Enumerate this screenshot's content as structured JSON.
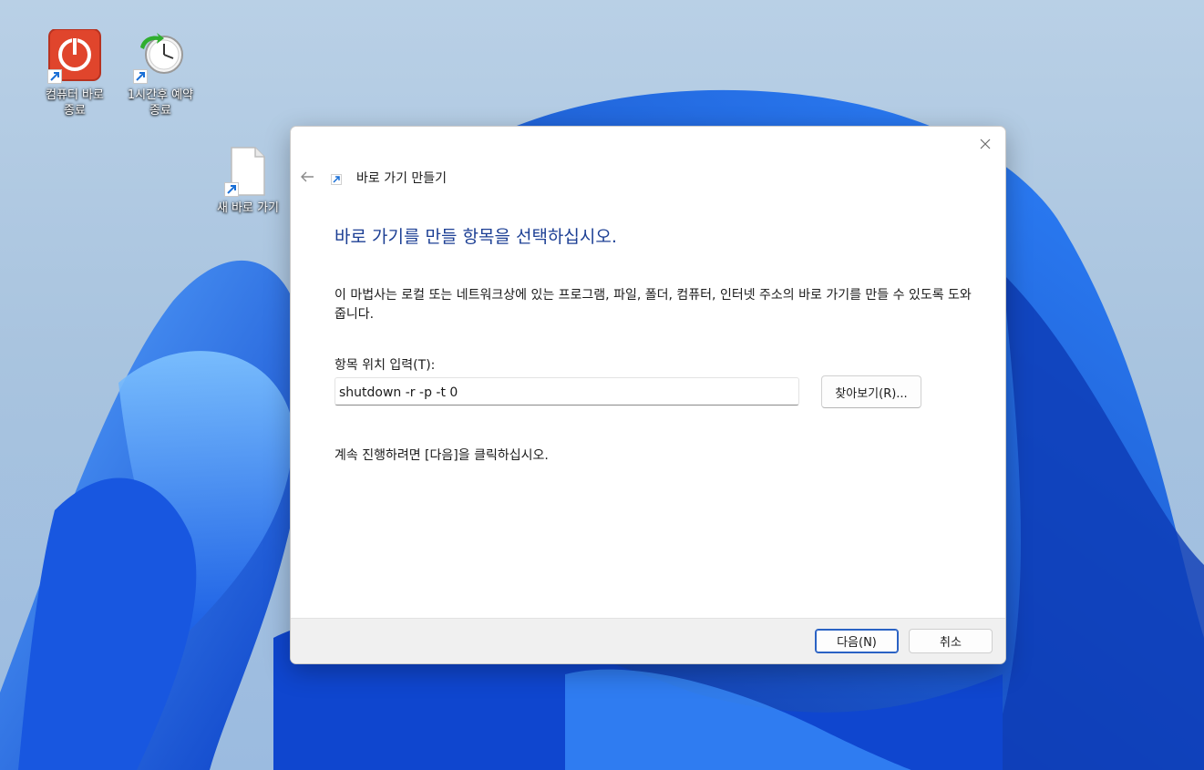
{
  "desktop": {
    "icons": [
      {
        "label_line1": "컴퓨터 바로",
        "label_line2": "종료",
        "icon": "power-icon"
      },
      {
        "label_line1": "1시간후 예약",
        "label_line2": "종료",
        "icon": "clock-icon"
      },
      {
        "label_line1": "새 바로 가기",
        "label_line2": "",
        "icon": "blank-document-icon"
      }
    ]
  },
  "dialog": {
    "wizard_title": "바로 가기 만들기",
    "heading": "바로 가기를 만들 항목을 선택하십시오.",
    "description": "이 마법사는 로컬 또는 네트워크상에 있는 프로그램, 파일, 폴더, 컴퓨터, 인터넷 주소의 바로 가기를 만들 수 있도록 도와줍니다.",
    "location_label": "항목 위치 입력(T):",
    "location_value": "shutdown -r -p -t 0",
    "browse_label": "찾아보기(R)...",
    "continue_text": "계속 진행하려면 [다음]을 클릭하십시오.",
    "next_label": "다음(N)",
    "cancel_label": "취소"
  },
  "colors": {
    "heading": "#1c3f94",
    "accent": "#2a62c4",
    "wallpaper_blue": "#1f6ff0"
  }
}
